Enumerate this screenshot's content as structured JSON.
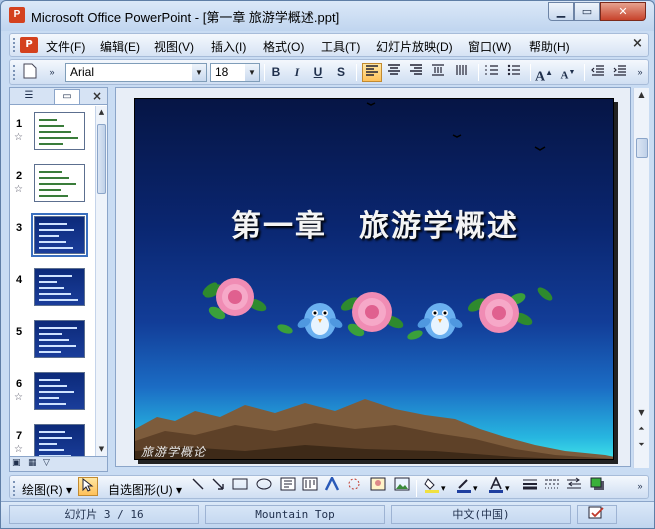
{
  "window": {
    "title": "Microsoft Office PowerPoint - [第一章 旅游学概述.ppt]",
    "app_icon": "powerpoint-icon",
    "min_label": "▁",
    "max_label": "▭",
    "close_label": "✕"
  },
  "menubar": {
    "items": [
      {
        "label": "文件(F)"
      },
      {
        "label": "编辑(E)"
      },
      {
        "label": "视图(V)"
      },
      {
        "label": "插入(I)"
      },
      {
        "label": "格式(O)"
      },
      {
        "label": "工具(T)"
      },
      {
        "label": "幻灯片放映(D)"
      },
      {
        "label": "窗口(W)"
      },
      {
        "label": "帮助(H)"
      }
    ],
    "close_label": "×"
  },
  "format_toolbar": {
    "font_name": "Arial",
    "font_size": "18",
    "bold_label": "B",
    "italic_label": "I",
    "underline_label": "U",
    "shadow_label": "S",
    "align_left_icon": "align-left-icon",
    "increase_font_label": "A",
    "decrease_font_label": "A"
  },
  "left_pane": {
    "thumbnails": [
      {
        "num": "1",
        "style": "white"
      },
      {
        "num": "2",
        "style": "white"
      },
      {
        "num": "3",
        "style": "blue"
      },
      {
        "num": "4",
        "style": "blue"
      },
      {
        "num": "5",
        "style": "blue"
      },
      {
        "num": "6",
        "style": "blue"
      },
      {
        "num": "7",
        "style": "blue"
      }
    ],
    "selected_index": 3
  },
  "slide": {
    "title": "第一章　旅游学概述",
    "footer": "旅游学概论",
    "colors": {
      "sky_top": "#061545",
      "sky_bottom": "#3fe0e8",
      "mountain": "#8a6a4a",
      "rose": "#f08cb4",
      "leaf": "#2e8a2e",
      "bird": "#6ab0f0"
    }
  },
  "draw_toolbar": {
    "draw_label": "绘图(R)",
    "autoshape_label": "自选图形(U)"
  },
  "statusbar": {
    "slide_info": "幻灯片 3 / 16",
    "design": "Mountain Top",
    "language": "中文(中国)"
  }
}
